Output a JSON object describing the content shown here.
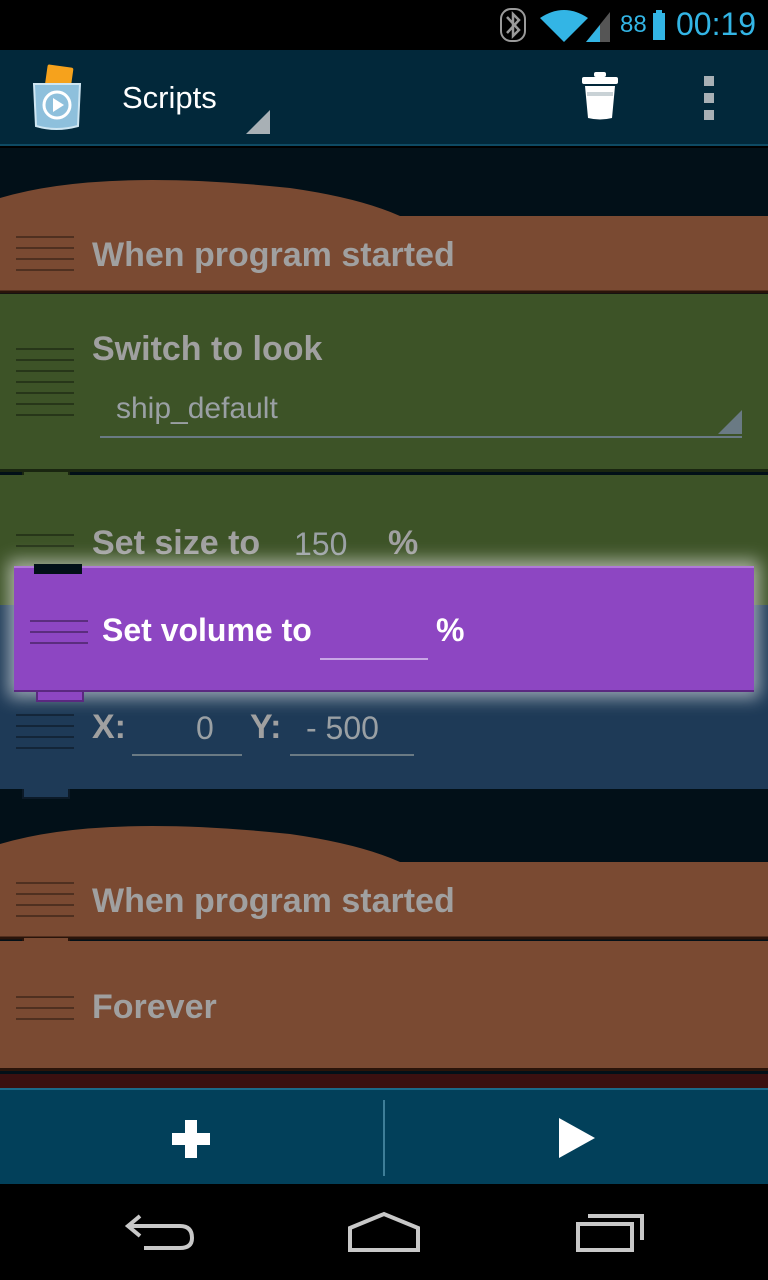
{
  "status_bar": {
    "battery_level": "88",
    "time": "00:19",
    "icons": [
      "bluetooth-icon",
      "wifi-icon",
      "signal-icon",
      "battery-icon"
    ],
    "accent_color": "#33b5e5"
  },
  "action_bar": {
    "title": "Scripts",
    "icons": [
      "app-icon",
      "trash-icon",
      "overflow-menu-icon"
    ],
    "background_color": "#02283a"
  },
  "scripts": [
    {
      "hat_label": "When program started",
      "bricks": [
        {
          "type": "look",
          "label": "Switch to look",
          "dropdown_value": "ship_default",
          "color": "#3d5327"
        },
        {
          "type": "look",
          "label": "Set size to",
          "value": "150",
          "unit": "%",
          "color": "#3d5327"
        },
        {
          "type": "motion",
          "x_label": "X:",
          "x_value": "0",
          "y_label": "Y:",
          "y_value": "- 500",
          "color": "#1e3a57"
        }
      ]
    },
    {
      "hat_label": "When program started",
      "bricks": [
        {
          "type": "control",
          "label": "Forever",
          "color": "#7a4a32"
        }
      ]
    }
  ],
  "dragged_brick": {
    "label": "Set volume to",
    "value": "",
    "unit": "%",
    "color": "#8d46c2"
  },
  "bottom_bar": {
    "buttons": [
      "add-icon",
      "play-icon"
    ]
  },
  "nav_bar": {
    "buttons": [
      "back-icon",
      "home-icon",
      "recent-apps-icon"
    ]
  }
}
